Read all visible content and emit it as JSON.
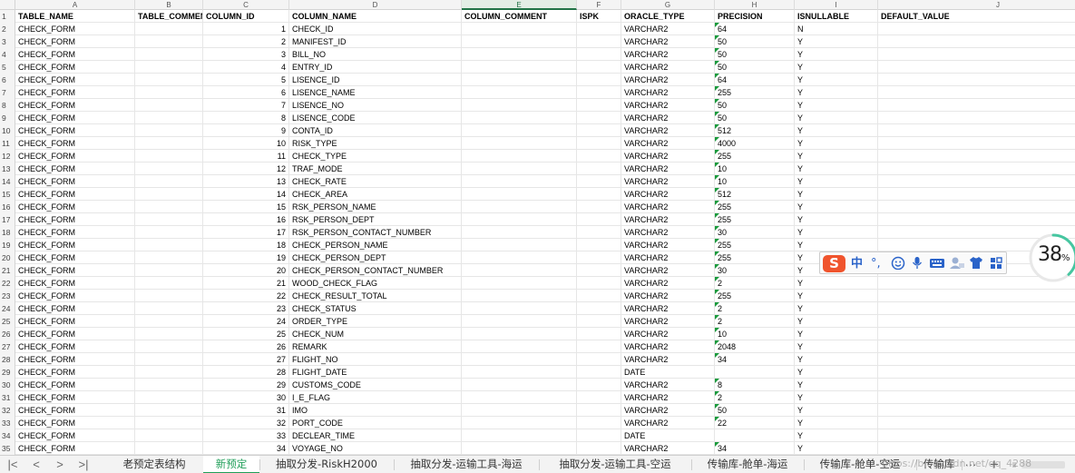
{
  "columns": [
    "A",
    "B",
    "C",
    "D",
    "E",
    "F",
    "G",
    "H",
    "I",
    "J"
  ],
  "selected_column": "E",
  "header_row": [
    "TABLE_NAME",
    "TABLE_COMMENT",
    "COLUMN_ID",
    "COLUMN_NAME",
    "COLUMN_COMMENT",
    "ISPK",
    "ORACLE_TYPE",
    "PRECISION",
    "ISNULLABLE",
    "DEFAULT_VALUE"
  ],
  "rows": [
    [
      "CHECK_FORM",
      "",
      "1",
      "CHECK_ID",
      "",
      "",
      "VARCHAR2",
      "64",
      "N"
    ],
    [
      "CHECK_FORM",
      "",
      "2",
      "MANIFEST_ID",
      "",
      "",
      "VARCHAR2",
      "50",
      "Y"
    ],
    [
      "CHECK_FORM",
      "",
      "3",
      "BILL_NO",
      "",
      "",
      "VARCHAR2",
      "50",
      "Y"
    ],
    [
      "CHECK_FORM",
      "",
      "4",
      "ENTRY_ID",
      "",
      "",
      "VARCHAR2",
      "50",
      "Y"
    ],
    [
      "CHECK_FORM",
      "",
      "5",
      "LISENCE_ID",
      "",
      "",
      "VARCHAR2",
      "64",
      "Y"
    ],
    [
      "CHECK_FORM",
      "",
      "6",
      "LISENCE_NAME",
      "",
      "",
      "VARCHAR2",
      "255",
      "Y"
    ],
    [
      "CHECK_FORM",
      "",
      "7",
      "LISENCE_NO",
      "",
      "",
      "VARCHAR2",
      "50",
      "Y"
    ],
    [
      "CHECK_FORM",
      "",
      "8",
      "LISENCE_CODE",
      "",
      "",
      "VARCHAR2",
      "50",
      "Y"
    ],
    [
      "CHECK_FORM",
      "",
      "9",
      "CONTA_ID",
      "",
      "",
      "VARCHAR2",
      "512",
      "Y"
    ],
    [
      "CHECK_FORM",
      "",
      "10",
      "RISK_TYPE",
      "",
      "",
      "VARCHAR2",
      "4000",
      "Y"
    ],
    [
      "CHECK_FORM",
      "",
      "11",
      "CHECK_TYPE",
      "",
      "",
      "VARCHAR2",
      "255",
      "Y"
    ],
    [
      "CHECK_FORM",
      "",
      "12",
      "TRAF_MODE",
      "",
      "",
      "VARCHAR2",
      "10",
      "Y"
    ],
    [
      "CHECK_FORM",
      "",
      "13",
      "CHECK_RATE",
      "",
      "",
      "VARCHAR2",
      "10",
      "Y"
    ],
    [
      "CHECK_FORM",
      "",
      "14",
      "CHECK_AREA",
      "",
      "",
      "VARCHAR2",
      "512",
      "Y"
    ],
    [
      "CHECK_FORM",
      "",
      "15",
      "RSK_PERSON_NAME",
      "",
      "",
      "VARCHAR2",
      "255",
      "Y"
    ],
    [
      "CHECK_FORM",
      "",
      "16",
      "RSK_PERSON_DEPT",
      "",
      "",
      "VARCHAR2",
      "255",
      "Y"
    ],
    [
      "CHECK_FORM",
      "",
      "17",
      "RSK_PERSON_CONTACT_NUMBER",
      "",
      "",
      "VARCHAR2",
      "30",
      "Y"
    ],
    [
      "CHECK_FORM",
      "",
      "18",
      "CHECK_PERSON_NAME",
      "",
      "",
      "VARCHAR2",
      "255",
      "Y"
    ],
    [
      "CHECK_FORM",
      "",
      "19",
      "CHECK_PERSON_DEPT",
      "",
      "",
      "VARCHAR2",
      "255",
      "Y"
    ],
    [
      "CHECK_FORM",
      "",
      "20",
      "CHECK_PERSON_CONTACT_NUMBER",
      "",
      "",
      "VARCHAR2",
      "30",
      "Y"
    ],
    [
      "CHECK_FORM",
      "",
      "21",
      "WOOD_CHECK_FLAG",
      "",
      "",
      "VARCHAR2",
      "2",
      "Y"
    ],
    [
      "CHECK_FORM",
      "",
      "22",
      "CHECK_RESULT_TOTAL",
      "",
      "",
      "VARCHAR2",
      "255",
      "Y"
    ],
    [
      "CHECK_FORM",
      "",
      "23",
      "CHECK_STATUS",
      "",
      "",
      "VARCHAR2",
      "2",
      "Y"
    ],
    [
      "CHECK_FORM",
      "",
      "24",
      "ORDER_TYPE",
      "",
      "",
      "VARCHAR2",
      "2",
      "Y"
    ],
    [
      "CHECK_FORM",
      "",
      "25",
      "CHECK_NUM",
      "",
      "",
      "VARCHAR2",
      "10",
      "Y"
    ],
    [
      "CHECK_FORM",
      "",
      "26",
      "REMARK",
      "",
      "",
      "VARCHAR2",
      "2048",
      "Y"
    ],
    [
      "CHECK_FORM",
      "",
      "27",
      "FLIGHT_NO",
      "",
      "",
      "VARCHAR2",
      "34",
      "Y"
    ],
    [
      "CHECK_FORM",
      "",
      "28",
      "FLIGHT_DATE",
      "",
      "",
      "DATE",
      "",
      "Y"
    ],
    [
      "CHECK_FORM",
      "",
      "29",
      "CUSTOMS_CODE",
      "",
      "",
      "VARCHAR2",
      "8",
      "Y"
    ],
    [
      "CHECK_FORM",
      "",
      "30",
      "I_E_FLAG",
      "",
      "",
      "VARCHAR2",
      "2",
      "Y"
    ],
    [
      "CHECK_FORM",
      "",
      "31",
      "IMO",
      "",
      "",
      "VARCHAR2",
      "50",
      "Y"
    ],
    [
      "CHECK_FORM",
      "",
      "32",
      "PORT_CODE",
      "",
      "",
      "VARCHAR2",
      "22",
      "Y"
    ],
    [
      "CHECK_FORM",
      "",
      "33",
      "DECLEAR_TIME",
      "",
      "",
      "DATE",
      "",
      "Y"
    ],
    [
      "CHECK_FORM",
      "",
      "34",
      "VOYAGE_NO",
      "",
      "",
      "VARCHAR2",
      "34",
      "Y"
    ]
  ],
  "tabs": [
    "老预定表结构",
    "新预定",
    "抽取分发-RiskH2000",
    "抽取分发-运输工具-海运",
    "抽取分发-运输工具-空运",
    "传输库-舱单-海运",
    "传输库-舱单-空运",
    "传输库"
  ],
  "active_tab": "新预定",
  "nav_buttons": [
    "|<",
    "<",
    ">",
    ">|"
  ],
  "tab_more": "···",
  "tab_add": "+",
  "ime": {
    "logo": "S",
    "lang": "中",
    "punct": "°,"
  },
  "progress": {
    "value": 38,
    "label": "38",
    "unit": "%"
  },
  "watermark": "https://blog.csdn.net/qq_4288"
}
